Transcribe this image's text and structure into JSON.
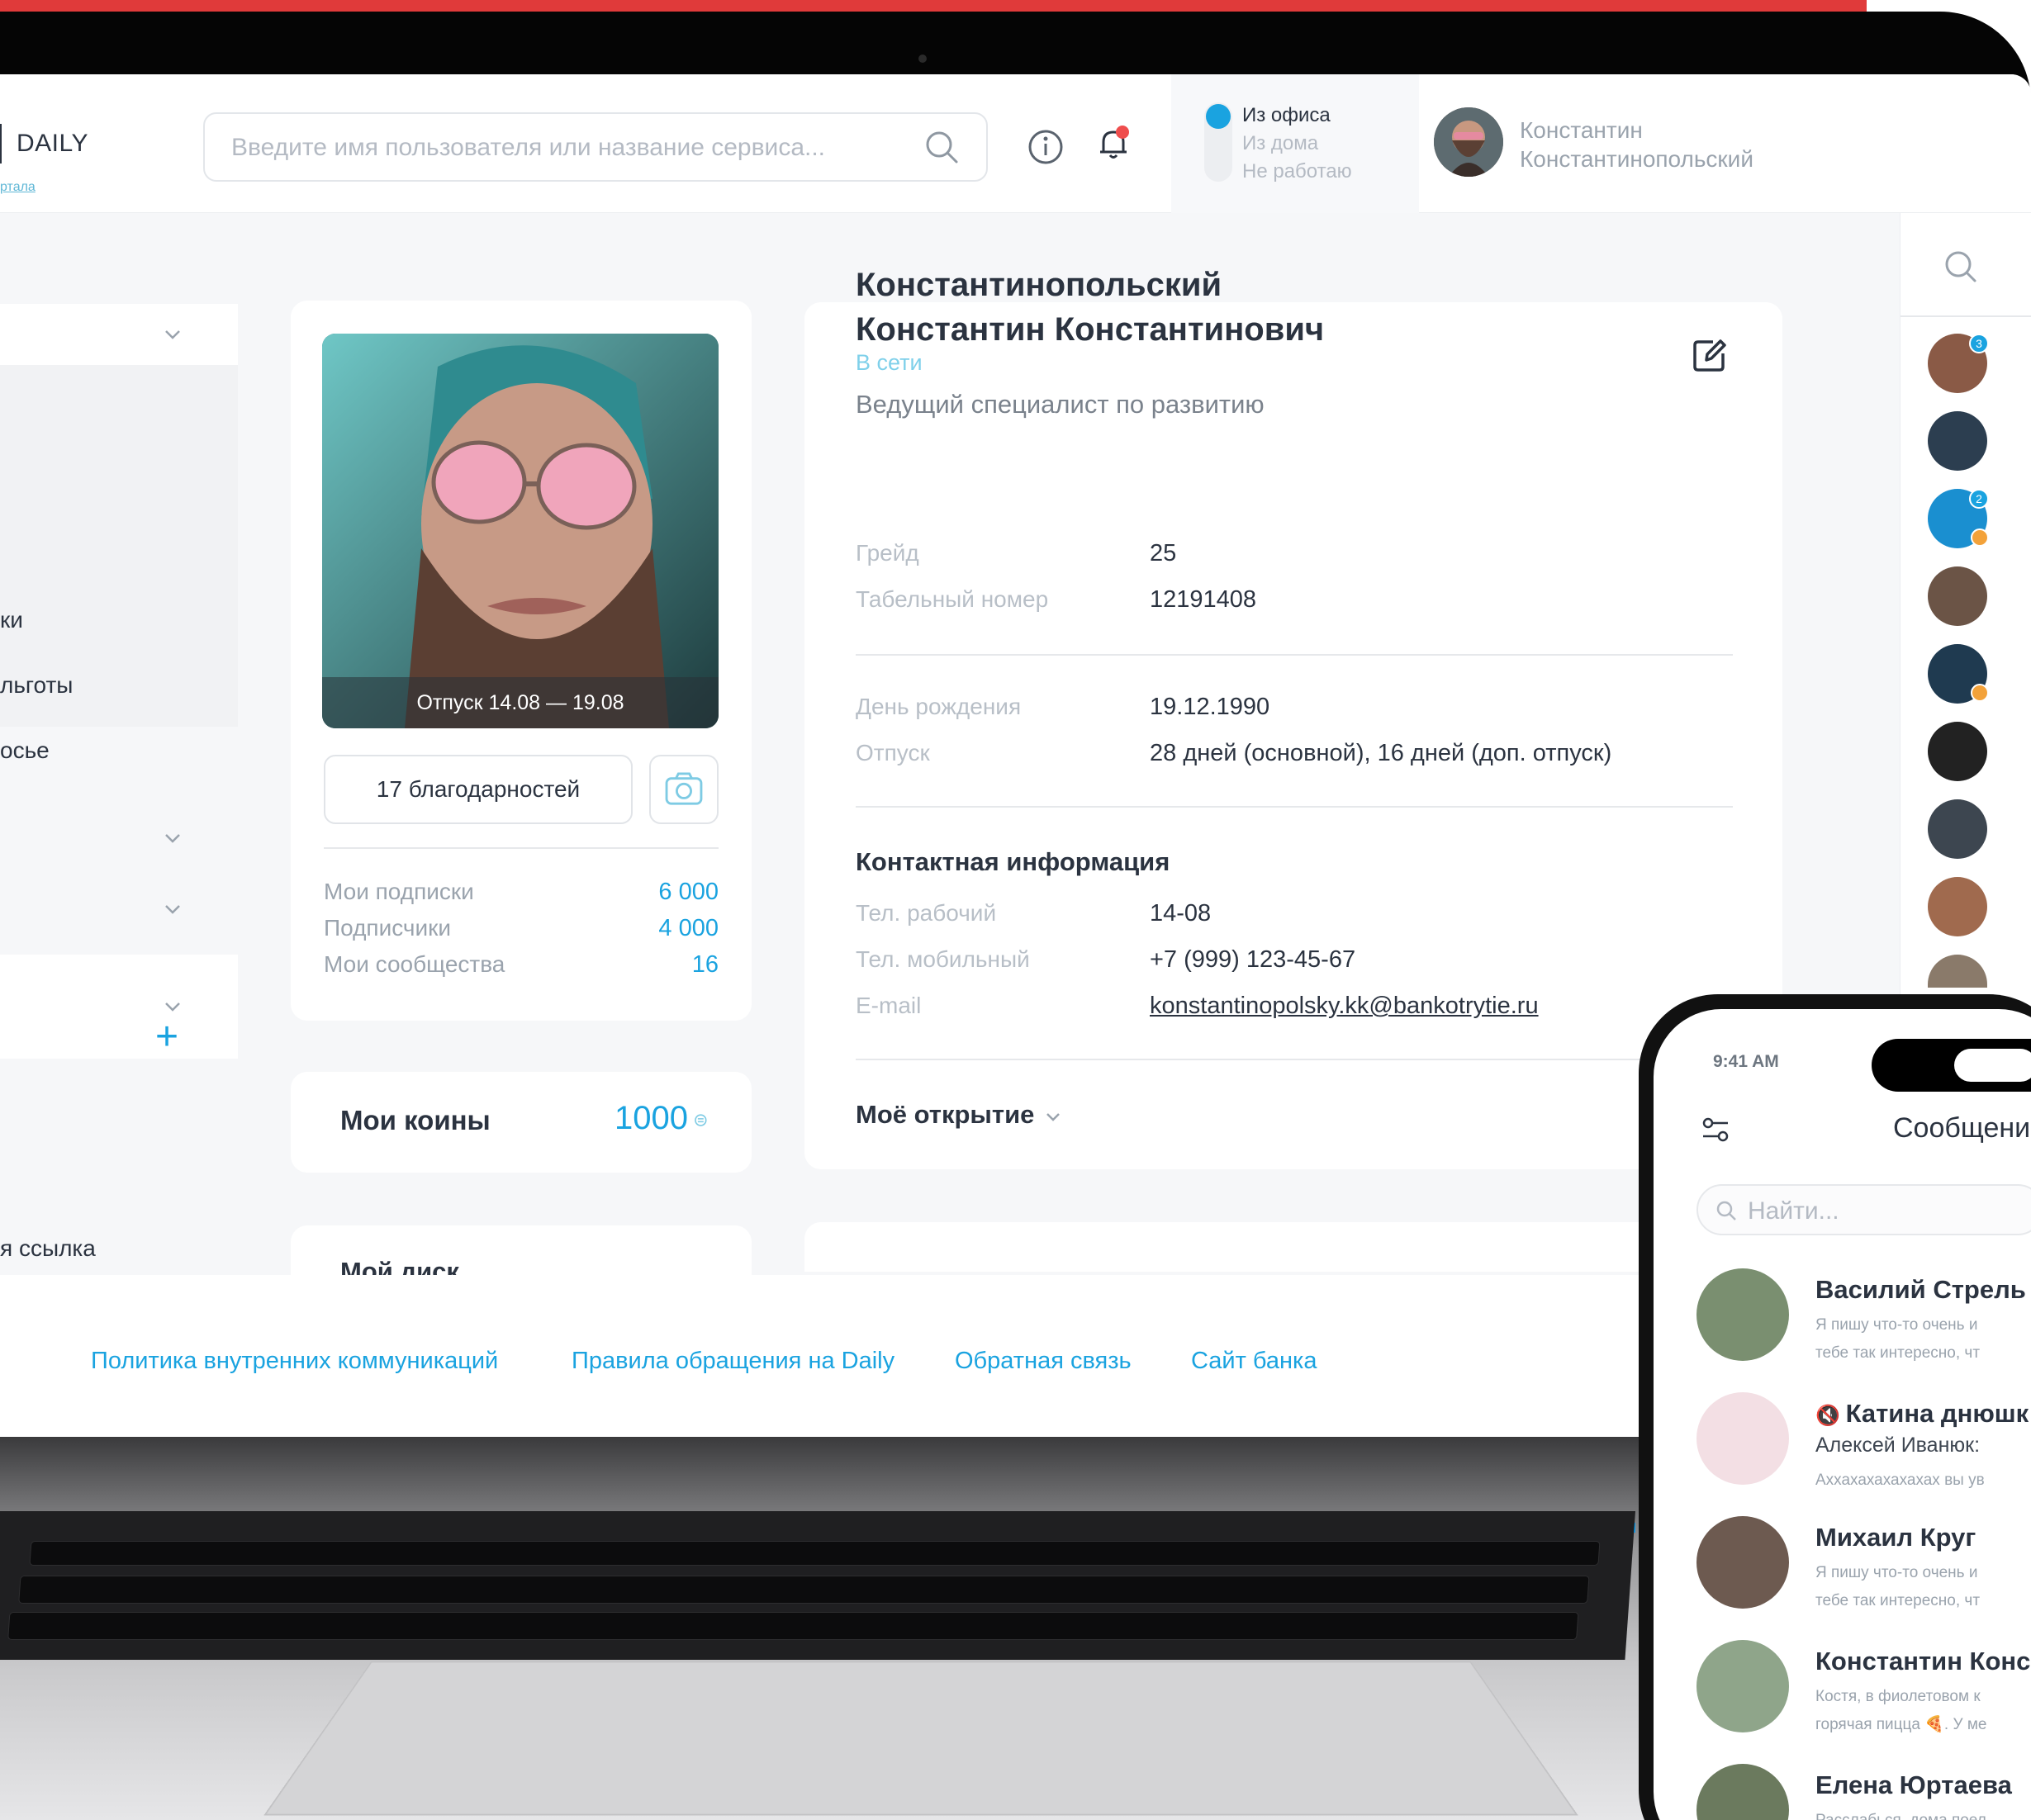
{
  "header": {
    "logo_text": "DAILY",
    "logo_sub": "ртала",
    "search_placeholder": "Введите имя пользователя или название сервиса...",
    "status_options": [
      "Из офиса",
      "Из дома",
      "Не работаю"
    ],
    "user_first": "Константин",
    "user_last": "Константинопольский"
  },
  "sidebar": {
    "items": [
      "ки",
      "льготы",
      "осье"
    ],
    "link": "я ссылка"
  },
  "profile": {
    "vacation_badge": "Отпуск 14.08 — 19.08",
    "thanks": "17 благодарностей",
    "stats": [
      {
        "label": "Мои подписки",
        "value": "6 000"
      },
      {
        "label": "Подписчики",
        "value": "4 000"
      },
      {
        "label": "Мои сообщества",
        "value": "16"
      }
    ],
    "coins_label": "Мои коины",
    "coins_value": "1000",
    "disk_label": "Мой диск",
    "surname": "Константинопольский",
    "name_patronymic": "Константин Константинович",
    "online": "В сети",
    "position": "Ведущий специалист по развитию",
    "fields": [
      {
        "label": "Грейд",
        "value": "25"
      },
      {
        "label": "Табельный номер",
        "value": "12191408"
      },
      {
        "label": "День рождения",
        "value": "19.12.1990"
      },
      {
        "label": "Отпуск",
        "value": "28 дней (основной), 16 дней (доп. отпуск)"
      }
    ],
    "contacts_title": "Контактная информация",
    "contacts": [
      {
        "label": "Тел. рабочий",
        "value": "14-08"
      },
      {
        "label": "Тел. мобильный",
        "value": "+7 (999) 123-45-67"
      },
      {
        "label": "E-mail",
        "value": "konstantinopolsky.kk@bankotrytie.ru"
      }
    ],
    "my_otkritie": "Моё открытие"
  },
  "rail": {
    "badges": [
      "3",
      "2"
    ]
  },
  "footer": {
    "links": [
      "Политика внутренних коммуникаций",
      "Правила обращения на Daily",
      "Обратная связь",
      "Сайт банка"
    ]
  },
  "phone": {
    "time": "9:41 AM",
    "title": "Сообщени",
    "search_placeholder": "Найти...",
    "chats": [
      {
        "name": "Василий Стрель",
        "sender": "",
        "msg1": "Я пишу что-то очень и",
        "msg2": "тебе так интересно, чт"
      },
      {
        "name": "Катина днюшк",
        "sender": "Алексей Иванюк:",
        "msg1": "Аххахахахахахах вы ув",
        "msg2": ""
      },
      {
        "name": "Михаил Круг",
        "sender": "",
        "msg1": "Я пишу что-то очень и",
        "msg2": "тебе так интересно, чт"
      },
      {
        "name": "Константин Конс",
        "sender": "",
        "msg1": "Костя, в фиолетовом к",
        "msg2": "горячая пицца 🍕. У ме"
      },
      {
        "name": "Елена Юртаева",
        "sender": "",
        "msg1": "Расслабься, дома поел",
        "msg2": ""
      }
    ]
  },
  "colors": {
    "accent": "#1aa3e0",
    "brand_red": "#e03a3a",
    "text": "#2b3340",
    "muted": "#b8bfc7"
  }
}
